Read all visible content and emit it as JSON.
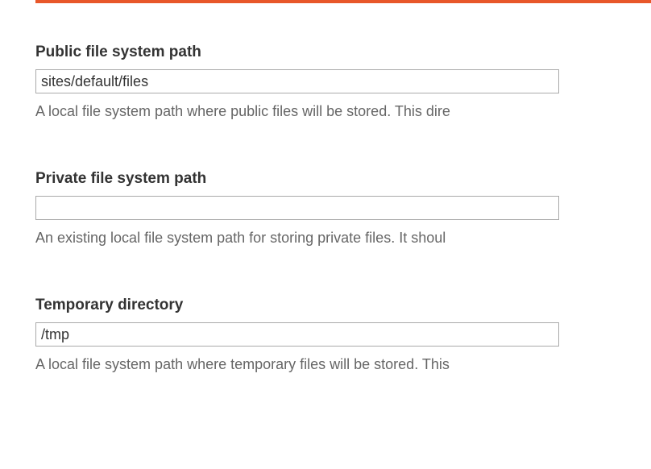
{
  "fields": {
    "public_path": {
      "label": "Public file system path",
      "value": "sites/default/files",
      "description": "A local file system path where public files will be stored. This dire"
    },
    "private_path": {
      "label": "Private file system path",
      "value": "",
      "description": "An existing local file system path for storing private files. It shoul"
    },
    "temp_dir": {
      "label": "Temporary directory",
      "value": "/tmp",
      "description": "A local file system path where temporary files will be stored. This"
    }
  }
}
